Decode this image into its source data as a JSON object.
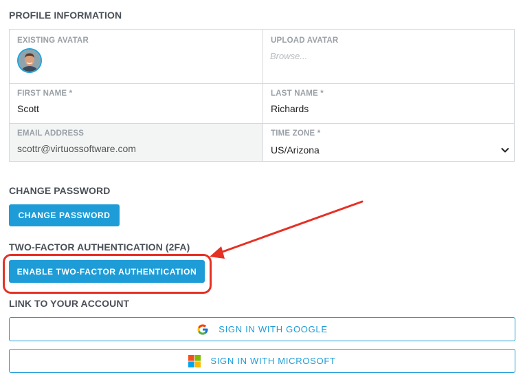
{
  "profile": {
    "section_title": "PROFILE INFORMATION",
    "existing_avatar_label": "EXISTING AVATAR",
    "upload_avatar_label": "UPLOAD AVATAR",
    "upload_placeholder": "Browse...",
    "first_name_label": "FIRST NAME *",
    "first_name_value": "Scott",
    "last_name_label": "LAST NAME *",
    "last_name_value": "Richards",
    "email_label": "EMAIL ADDRESS",
    "email_value": "scottr@virtuossoftware.com",
    "timezone_label": "TIME ZONE *",
    "timezone_value": "US/Arizona"
  },
  "password": {
    "section_title": "CHANGE PASSWORD",
    "button_label": "CHANGE PASSWORD"
  },
  "twofa": {
    "section_title": "TWO-FACTOR AUTHENTICATION (2FA)",
    "button_label": "ENABLE TWO-FACTOR AUTHENTICATION"
  },
  "link_account": {
    "section_title": "LINK TO YOUR ACCOUNT",
    "google_label": "SIGN IN WITH GOOGLE",
    "microsoft_label": "SIGN IN WITH MICROSOFT"
  },
  "icons": {
    "google": "google-icon",
    "microsoft": "microsoft-icon",
    "chevron": "chevron-down-icon"
  },
  "colors": {
    "accent": "#1e9cd7",
    "annotation": "#e63024"
  }
}
